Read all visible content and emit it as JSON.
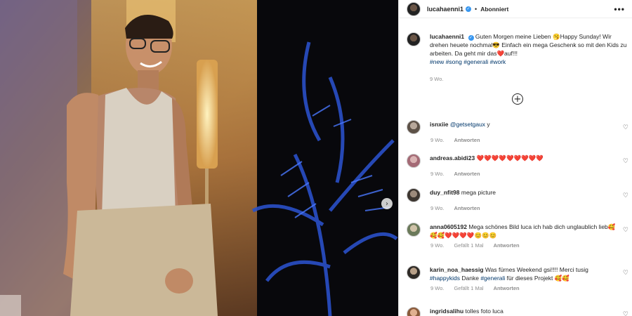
{
  "post": {
    "username": "lucahaenni1",
    "verified_mark": "✓",
    "separator": "•",
    "follow_state": "Abonniert",
    "more_label": "•••",
    "next_arrow": "›"
  },
  "caption": {
    "username": "lucahaenni1",
    "text_1": "Guten Morgen meine Lieben 🥱Happy Sunday! Wir drehen heuete nochmal😎 Einfach ein mega Geschenk so mit den Kids zu arbeiten. Da geht mir das",
    "heart_emoji": "❤️",
    "text_2": "auf!!!",
    "hashtags": [
      "#new",
      "#song",
      "#generali",
      "#work"
    ],
    "time": "9 Wo."
  },
  "load_more_label": "+",
  "comments": [
    {
      "username": "isnxiie",
      "mention": "@getsetgaux",
      "text": " y",
      "time": "9 Wo.",
      "likes": "",
      "reply": "Antworten"
    },
    {
      "username": "andreas.abidi23",
      "text": "❤️❤️❤️❤️❤️❤️❤️❤️❤️",
      "time": "9 Wo.",
      "likes": "",
      "reply": "Antworten"
    },
    {
      "username": "duy_nfit98",
      "text": "mega picture",
      "time": "9 Wo.",
      "likes": "",
      "reply": "Antworten"
    },
    {
      "username": "anna0605192",
      "text": "Mega schönes Bild luca ich hab dich unglaublich lieb🥰🥰🥰❤️❤️❤️❤️😊😊😊",
      "time": "9 Wo.",
      "likes": "Gefällt 1 Mal",
      "reply": "Antworten"
    },
    {
      "username": "karin_noa_haessig",
      "text_a": "Was fürnes Weekend gsi!!!! Merci tusig ",
      "tag1": "#happykids",
      "text_b": " Danke ",
      "tag2": "#generali",
      "text_c": " für dieses Projekt 🥰🥰",
      "time": "9 Wo.",
      "likes": "Gefällt 1 Mal",
      "reply": "Antworten"
    },
    {
      "username": "ingridsalihu",
      "text": "tolles foto luca",
      "time": "",
      "likes": "",
      "reply": ""
    }
  ],
  "heart_icon": "♡"
}
